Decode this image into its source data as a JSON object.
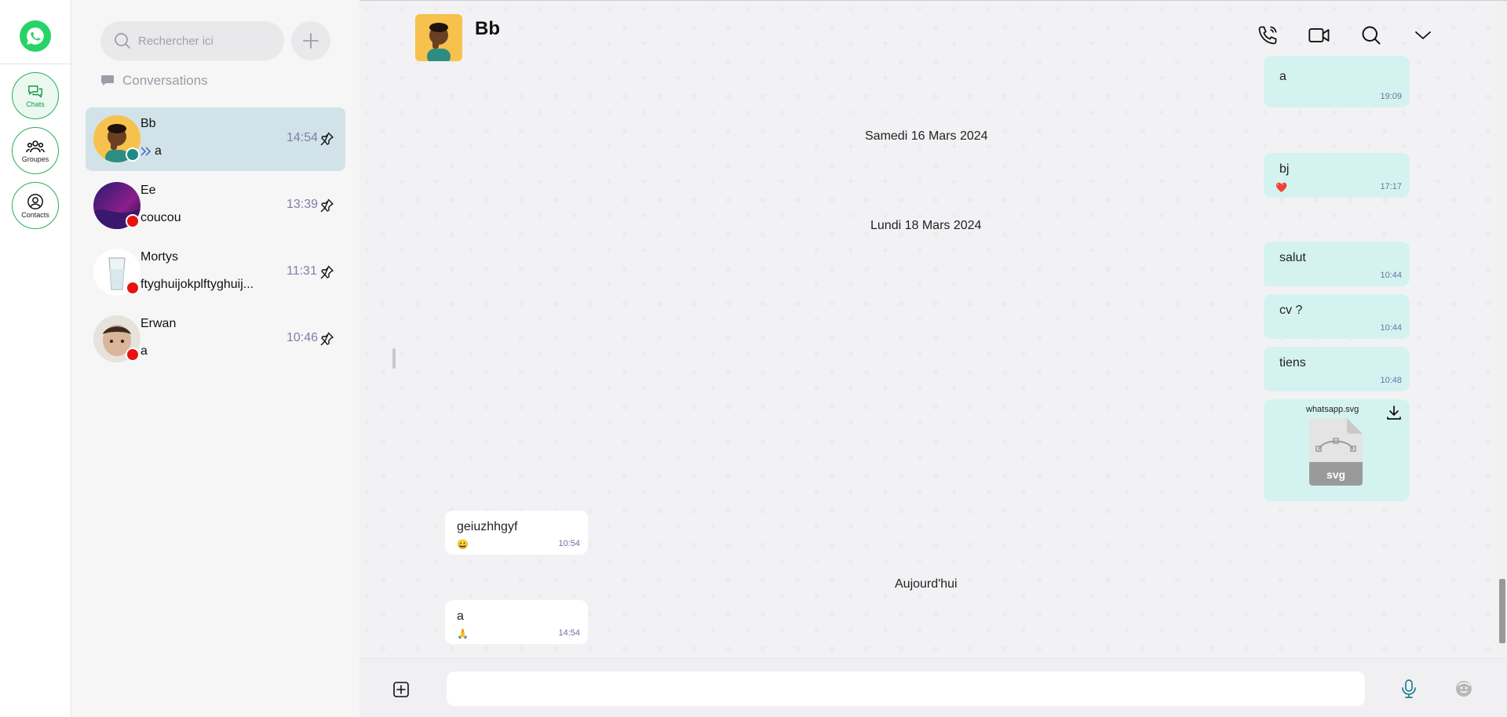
{
  "rail": {
    "nav": [
      {
        "label": "Chats"
      },
      {
        "label": "Groupes"
      },
      {
        "label": "Contacts"
      }
    ]
  },
  "sidebar": {
    "search_placeholder": "Rechercher ici",
    "section_title": "Conversations",
    "conversations": [
      {
        "name": "Bb",
        "preview": "a",
        "time": "14:54",
        "status_color": "#1f8a86"
      },
      {
        "name": "Ee",
        "preview": "coucou",
        "time": "13:39",
        "status_color": "#e81212"
      },
      {
        "name": "Mortys",
        "preview": "ftyghuijokplftyghuij...",
        "time": "11:31",
        "status_color": "#e81212"
      },
      {
        "name": "Erwan",
        "preview": "a",
        "time": "10:46",
        "status_color": "#e81212"
      }
    ]
  },
  "chat": {
    "contact_name": "Bb",
    "messages_top": {
      "text": "a",
      "time": "19:09"
    },
    "date_1": "Samedi 16 Mars 2024",
    "msg_bj": {
      "text": "bj",
      "time": "17:17",
      "reaction": "❤️"
    },
    "date_2": "Lundi 18 Mars 2024",
    "msg_salut": {
      "text": "salut",
      "time": "10:44"
    },
    "msg_cv": {
      "text": "cv ?",
      "time": "10:44"
    },
    "msg_tiens": {
      "text": "tiens",
      "time": "10:48"
    },
    "file": {
      "name": "whatsapp.svg",
      "ext": "svg"
    },
    "msg_in_1": {
      "text": "geiuzhhgyf",
      "time": "10:54",
      "reaction": "😀"
    },
    "date_3": "Aujourd'hui",
    "msg_in_2": {
      "text": "a",
      "time": "14:54",
      "reaction": "🙏"
    }
  },
  "colors": {
    "accent": "#25d366",
    "bubble_out": "#d4f3f0",
    "active_conv": "#d1e3e8",
    "time_color": "#7d7fa8"
  }
}
